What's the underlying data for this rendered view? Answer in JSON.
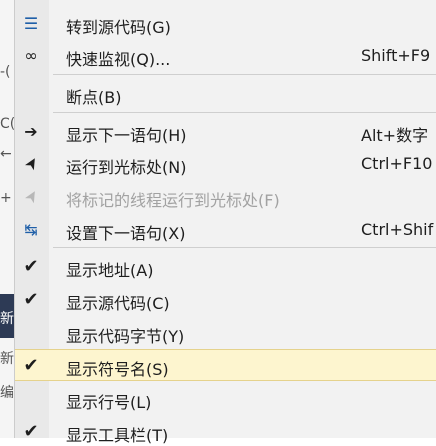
{
  "background": {
    "fragments": [
      "-(",
      "C(",
      "←",
      "+",
      "新",
      "新",
      "编"
    ]
  },
  "menu": {
    "items": [
      {
        "label": "转到源代码(G)",
        "shortcut": "",
        "icon": "goto-source-icon",
        "glyph": "☰"
      },
      {
        "label": "快速监视(Q)...",
        "shortcut": "Shift+F9",
        "icon": "glasses-icon",
        "glyph": "∞"
      },
      {
        "label": "断点(B)",
        "shortcut": "",
        "icon": "",
        "glyph": ""
      },
      {
        "label": "显示下一语句(H)",
        "shortcut": "Alt+数字",
        "icon": "arrow-right-icon",
        "glyph": "➔"
      },
      {
        "label": "运行到光标处(N)",
        "shortcut": "Ctrl+F10",
        "icon": "cursor-icon",
        "glyph": "➤"
      },
      {
        "label": "将标记的线程运行到光标处(F)",
        "shortcut": "",
        "icon": "cursor-icon",
        "glyph": "➤",
        "disabled": true
      },
      {
        "label": "设置下一语句(X)",
        "shortcut": "Ctrl+Shif",
        "icon": "set-next-statement-icon",
        "glyph": "↹"
      },
      {
        "label": "显示地址(A)",
        "shortcut": "",
        "icon": "check-icon",
        "glyph": "✔"
      },
      {
        "label": "显示源代码(C)",
        "shortcut": "",
        "icon": "check-icon",
        "glyph": "✔"
      },
      {
        "label": "显示代码字节(Y)",
        "shortcut": "",
        "icon": "",
        "glyph": ""
      },
      {
        "label": "显示符号名(S)",
        "shortcut": "",
        "icon": "check-icon",
        "glyph": "✔",
        "highlighted": true
      },
      {
        "label": "显示行号(L)",
        "shortcut": "",
        "icon": "",
        "glyph": ""
      },
      {
        "label": "显示工具栏(T)",
        "shortcut": "",
        "icon": "check-icon",
        "glyph": "✔"
      }
    ]
  }
}
